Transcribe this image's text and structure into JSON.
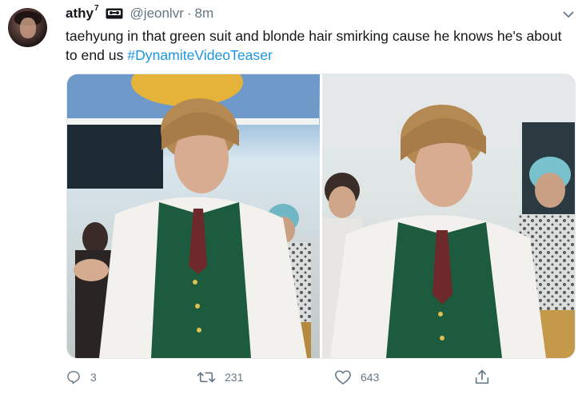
{
  "tweet": {
    "display_name": "athy",
    "name_superscript": "7",
    "handle": "@jeonlvr",
    "separator": "·",
    "time": "8m",
    "text_before_tag": "taehyung in that green suit and blonde hair smirking cause he knows he's about to end us ",
    "hashtag": "#DynamiteVideoTeaser",
    "badge_icon": "cassette-tape-icon",
    "menu_icon": "chevron-down-icon"
  },
  "actions": {
    "reply_count": "3",
    "retweet_count": "231",
    "like_count": "643",
    "share_icon": "share-icon"
  },
  "colors": {
    "text": "#14171a",
    "secondary": "#657786",
    "link": "#1b95e0",
    "border": "#e1e8ed",
    "vest_green": "#1d5b3e",
    "hair_blonde": "#b58a52"
  }
}
